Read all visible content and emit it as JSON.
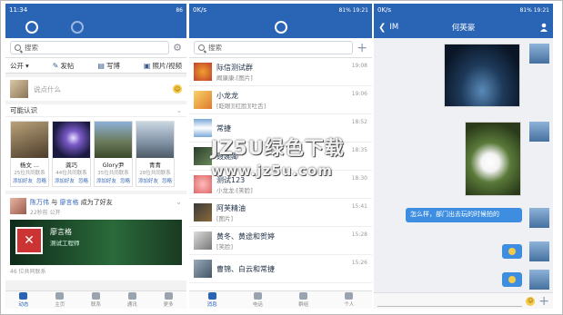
{
  "panel1": {
    "status": {
      "time": "11:34",
      "battery": "86"
    },
    "search_placeholder": "搜索",
    "scope": "公开",
    "actions": [
      "发帖",
      "写博",
      "照片/视频"
    ],
    "say_placeholder": "说点什么",
    "may_know_title": "可能认识",
    "cards": [
      {
        "name": "杨文 ...",
        "sub": "25位共同联系",
        "add": "添加好友",
        "ignore": "忽略"
      },
      {
        "name": "龚巧",
        "sub": "44位共同联系",
        "add": "添加好友",
        "ignore": "忽略"
      },
      {
        "name": "Glory尹",
        "sub": "35位共同联系",
        "add": "添加好友",
        "ignore": "忽略"
      },
      {
        "name": "青青",
        "sub": "28位共同联系",
        "add": "添加好友",
        "ignore": "忽略"
      }
    ],
    "feed": {
      "actor": "陈万伟",
      "connector": "与",
      "target": "廖言格",
      "action": "成为了好友",
      "time": "22秒前",
      "visibility": "公开",
      "card_name": "廖言格",
      "card_title": "测试工程师",
      "card_foot": "46 位共同联系"
    },
    "tabs": [
      "动态",
      "主页",
      "联系",
      "通讯",
      "更多"
    ]
  },
  "panel2": {
    "status": {
      "network": "0K/s",
      "battery": "81%",
      "time": "19:21"
    },
    "search_placeholder": "搜索",
    "conversations": [
      {
        "title": "际信测试群",
        "preview": "阚康康:[图片]",
        "time": "19:08"
      },
      {
        "title": "小龙龙",
        "preview": "[眨眼][红脸][吐舌]",
        "time": "19:06"
      },
      {
        "title": "常捷",
        "preview": "",
        "time": "18:52"
      },
      {
        "title": "聂婉卿",
        "preview": "",
        "time": "18:35"
      },
      {
        "title": "测试123",
        "preview": "小龙龙:[笑脸]",
        "time": "18:30"
      },
      {
        "title": "阿芙精油",
        "preview": "[图片]",
        "time": "15:41"
      },
      {
        "title": "黄冬、黄途和贺婷",
        "preview": "[笑脸]",
        "time": "15:28"
      },
      {
        "title": "曹锦、白云和常捷",
        "preview": "",
        "time": "15:26"
      }
    ],
    "tabs": [
      "消息",
      "电话",
      "群组",
      "个人"
    ]
  },
  "panel3": {
    "status": {
      "network": "0K/s",
      "battery": "81%",
      "time": "19:21"
    },
    "back_label": "IM",
    "title": "何英豪",
    "text_message": "怎么样，部门出去玩的时候拍的"
  },
  "watermark": {
    "text": "JZ5U绿色下载",
    "url": "www.jz5u.com"
  }
}
